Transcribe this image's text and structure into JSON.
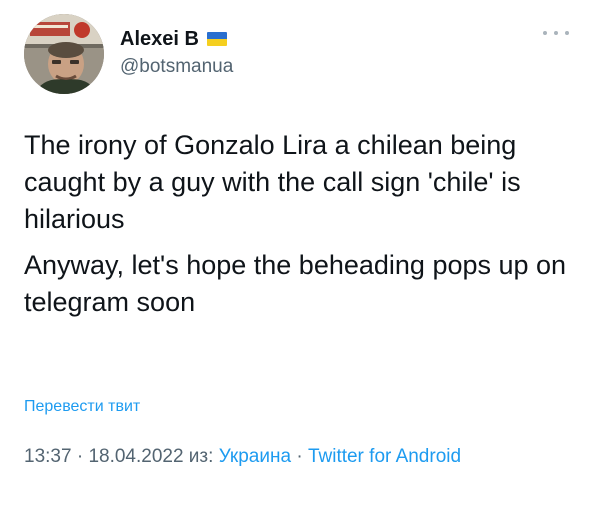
{
  "author": {
    "display_name": "Alexei B",
    "handle": "@botsmanua",
    "flag_colors": {
      "top": "#2a6fcf",
      "bottom": "#f5cf1f"
    }
  },
  "tweet": {
    "paragraphs": [
      "The irony of Gonzalo Lira a chilean being caught by a guy with the call sign 'chile' is hilarious",
      "Anyway, let's hope the beheading pops up on telegram soon"
    ],
    "translate_label": "Перевести твит"
  },
  "meta": {
    "time": "13:37",
    "sep1": " · ",
    "date": "18.04.2022",
    "from_label": " из: ",
    "location": "Украина",
    "sep2": " · ",
    "source": "Twitter for Android"
  },
  "colors": {
    "text": "#0f1419",
    "secondary": "#536471",
    "link": "#1d9bf0"
  },
  "icons": {
    "more": "more-dots-icon",
    "flag": "ukraine-flag-icon"
  }
}
